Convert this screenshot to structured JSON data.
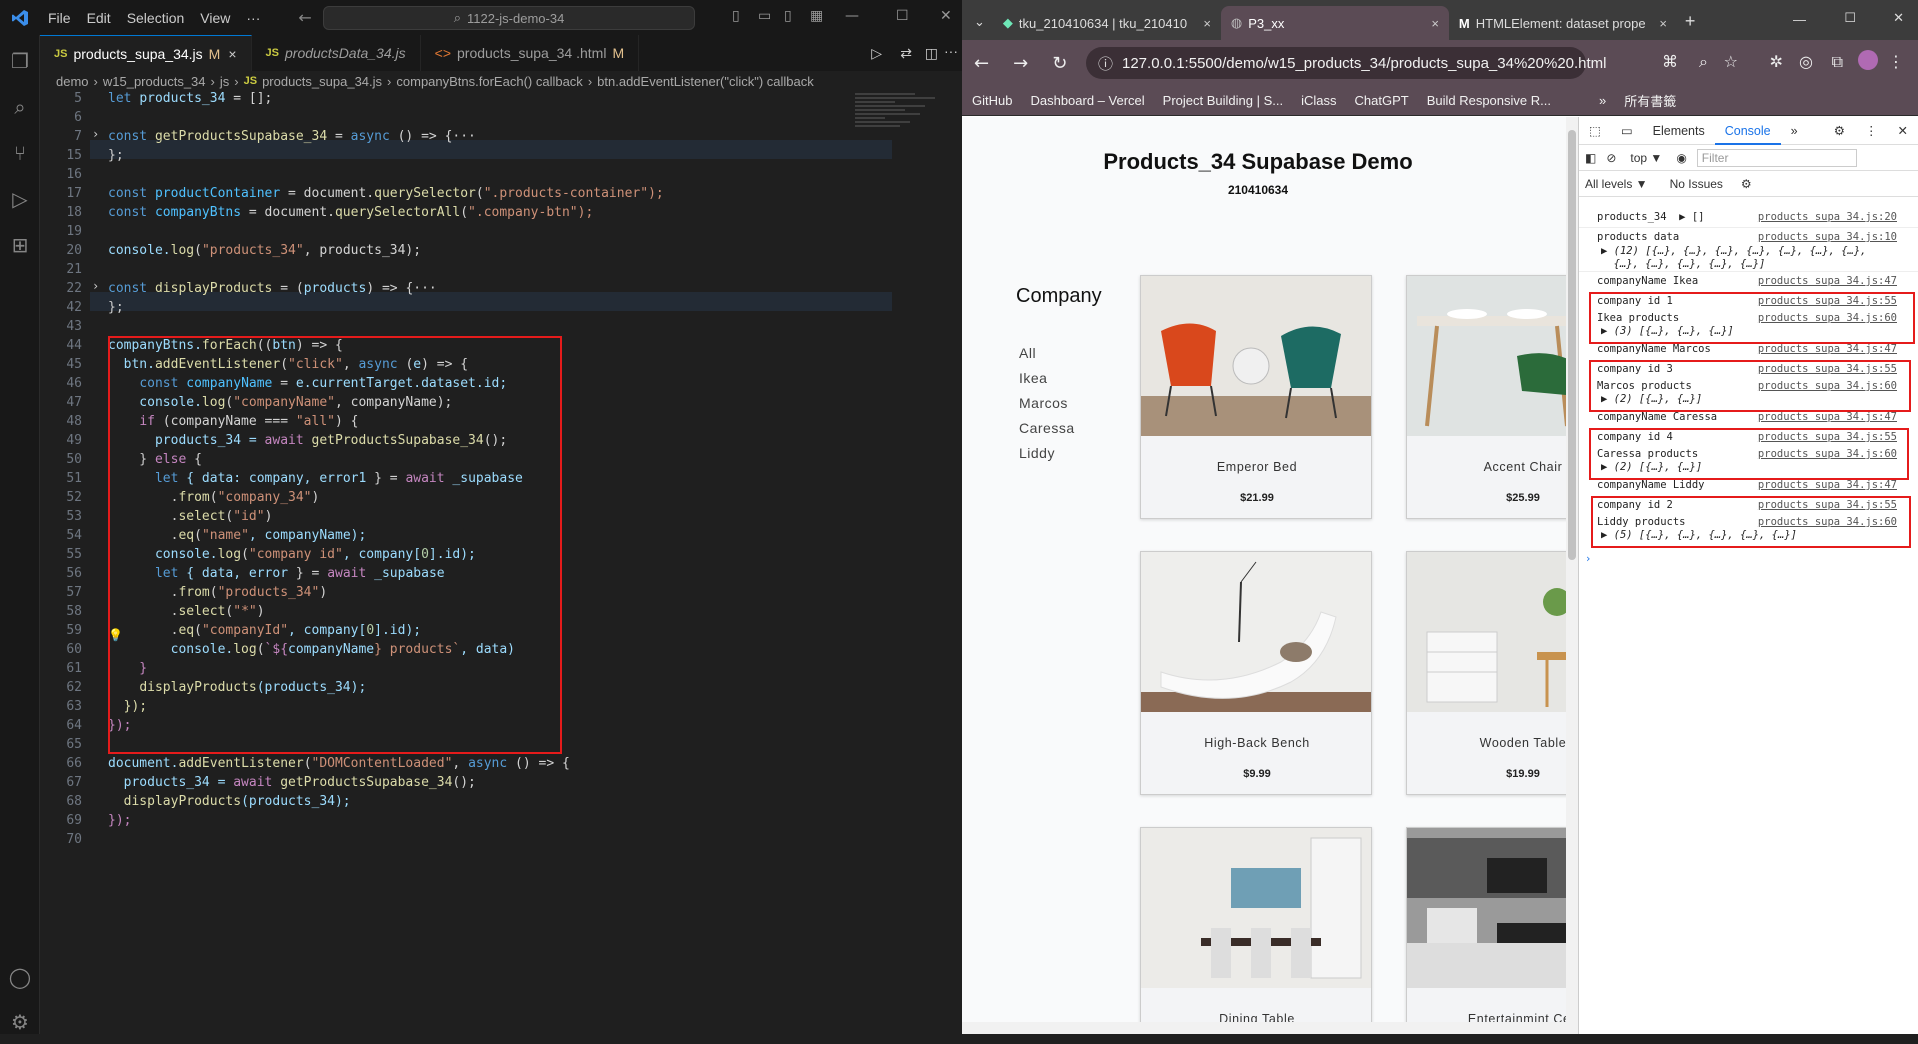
{
  "vscode": {
    "menus": [
      "File",
      "Edit",
      "Selection",
      "View",
      "···"
    ],
    "command_center": "1122-js-demo-34",
    "tabs": [
      {
        "kind": "JS",
        "label": "products_supa_34.js",
        "badge": "M",
        "active": true,
        "close": "×"
      },
      {
        "kind": "JS",
        "label": "productsData_34.js",
        "badge": "",
        "active": false,
        "close": ""
      },
      {
        "kind": "<>",
        "label": "products_supa_34 .html",
        "badge": "M",
        "active": false,
        "close": ""
      }
    ],
    "breadcrumbs": [
      "demo",
      "›",
      "w15_products_34",
      "›",
      "js",
      "›",
      "JS",
      "products_supa_34.js",
      "›",
      "companyBtns.forEach() callback",
      "›",
      "btn.addEventListener(\"click\") callback"
    ],
    "line_numbers": [
      "5",
      "6",
      "7",
      "15",
      "16",
      "17",
      "18",
      "19",
      "20",
      "21",
      "22",
      "42",
      "43",
      "44",
      "45",
      "46",
      "47",
      "48",
      "49",
      "50",
      "51",
      "52",
      "53",
      "54",
      "55",
      "56",
      "57",
      "58",
      "59",
      "60",
      "61",
      "62",
      "63",
      "64",
      "65",
      "66",
      "67",
      "68",
      "69",
      "70"
    ]
  },
  "code": {
    "l5": [
      "let ",
      "products_34",
      " = [];"
    ],
    "l7": [
      "const ",
      "getProductsSupabase_34",
      " = ",
      "async",
      " () => {",
      "···"
    ],
    "l15": "};",
    "l17": [
      "const ",
      "productContainer",
      " = document.",
      "querySelector",
      "(",
      ".products-container",
      "\");"
    ],
    "l18": [
      "const ",
      "companyBtns",
      " = document.",
      "querySelectorAll",
      "(",
      ".company-btn",
      "\");"
    ],
    "l20": [
      "console.",
      "log",
      "(",
      "\"products_34\"",
      ", products_34);"
    ],
    "l22": [
      "const ",
      "displayProducts",
      " = (",
      "products",
      ") => {",
      "···"
    ],
    "l42": "};",
    "l44": [
      "companyBtns.",
      "forEach",
      "((",
      "btn",
      ") => {"
    ],
    "l45": [
      "  btn.",
      "addEventListener",
      "(",
      "\"click\"",
      ", ",
      "async",
      " (",
      "e",
      ") => {"
    ],
    "l46": [
      "    ",
      "const ",
      "companyName",
      " = ",
      "e",
      ".currentTarget.dataset.id;"
    ],
    "l47": [
      "    console.",
      "log",
      "(",
      "\"companyName\"",
      ", companyName);"
    ],
    "l48": [
      "    ",
      "if",
      " (companyName === ",
      "\"all\"",
      ") {"
    ],
    "l49": [
      "      products_34 = ",
      "await ",
      "getProductsSupabase_34",
      "();"
    ],
    "l50": [
      "    } ",
      "else",
      " {"
    ],
    "l51": [
      "      ",
      "let",
      " { data: company, ",
      "error1",
      " } = ",
      "await",
      " _supabase"
    ],
    "l52": [
      "        .",
      "from",
      "(",
      "\"company_34\"",
      ")"
    ],
    "l53": [
      "        .",
      "select",
      "(",
      "\"id\"",
      ")"
    ],
    "l54": [
      "        .",
      "eq",
      "(",
      "\"name\"",
      ", companyName);"
    ],
    "l55": [
      "      console.",
      "log",
      "(",
      "\"company id\"",
      ", company[",
      "0",
      "].id);"
    ],
    "l56": [
      "      ",
      "let",
      " { data, ",
      "error",
      " } = ",
      "await",
      " _supabase"
    ],
    "l57": [
      "        .",
      "from",
      "(",
      "\"products_34\"",
      ")"
    ],
    "l58": [
      "        .",
      "select",
      "(",
      "\"*\"",
      ")"
    ],
    "l59": [
      "        .",
      "eq",
      "(",
      "\"companyId\"",
      ", company[",
      "0",
      "].id);"
    ],
    "l60": [
      "        console.",
      "log",
      "(",
      "`${",
      "companyName",
      "} products`",
      ", data)"
    ],
    "l61": "    }",
    "l62": [
      "    ",
      "displayProducts",
      "(products_34);"
    ],
    "l63": "  });",
    "l64": "});",
    "l66": [
      "document.",
      "addEventListener",
      "(",
      "\"DOMContentLoaded\"",
      ", ",
      "async",
      " () => {"
    ],
    "l67": [
      "  products_34 = ",
      "await ",
      "getProductsSupabase_34",
      "();"
    ],
    "l68": [
      "  ",
      "displayProducts",
      "(products_34);"
    ],
    "l69": "});"
  },
  "browser": {
    "tabs": [
      {
        "label": "tku_210410634 | tku_210410",
        "close": "×"
      },
      {
        "label": "P3_xx",
        "close": "×"
      },
      {
        "label": "HTMLElement: dataset prope",
        "close": "×"
      }
    ],
    "url": "127.0.0.1:5500/demo/w15_products_34/products_supa_34%20%20.html",
    "bookmarks": [
      "GitHub",
      "Dashboard – Vercel",
      "Project Building | S...",
      "iClass",
      "ChatGPT",
      "Build Responsive R...",
      "»",
      "所有書籤"
    ]
  },
  "page": {
    "title": "Products_34 Supabase Demo",
    "subtitle": "210410634",
    "company_heading": "Company",
    "companies": [
      "All",
      "Ikea",
      "Marcos",
      "Caressa",
      "Liddy"
    ],
    "products": [
      {
        "name": "Emperor Bed",
        "price": "$21.99"
      },
      {
        "name": "Accent Chair",
        "price": "$25.99"
      },
      {
        "name": "High-Back Bench",
        "price": "$9.99"
      },
      {
        "name": "Wooden Table",
        "price": "$19.99"
      },
      {
        "name": "Dining Table",
        "price": ""
      },
      {
        "name": "Entertainmint Cen",
        "price": ""
      }
    ]
  },
  "devtools": {
    "tabs": [
      "Elements",
      "Console",
      "»"
    ],
    "context": "top ▼",
    "filter_placeholder": "Filter",
    "levels": "All levels ▼",
    "issues": "No Issues",
    "logs": [
      {
        "text": "products_34  ▶ []",
        "src": "products supa 34.js:20"
      },
      {
        "text": "products data",
        "src": "products supa 34.js:10"
      },
      {
        "text": "▶ (12) [{…}, {…}, {…}, {…}, {…}, {…}, {…},",
        "src": ""
      },
      {
        "text": "  {…}, {…}, {…}, {…}, {…}]",
        "src": ""
      },
      {
        "text": "companyName Ikea",
        "src": "products supa 34.js:47"
      },
      {
        "text": "company id 1",
        "src": "products supa 34.js:55"
      },
      {
        "text": "Ikea products",
        "src": "products supa 34.js:60"
      },
      {
        "text": "▶ (3) [{…}, {…}, {…}]",
        "src": ""
      },
      {
        "text": "companyName Marcos",
        "src": "products supa 34.js:47"
      },
      {
        "text": "company id 3",
        "src": "products supa 34.js:55"
      },
      {
        "text": "Marcos products",
        "src": "products supa 34.js:60"
      },
      {
        "text": "▶ (2) [{…}, {…}]",
        "src": ""
      },
      {
        "text": "companyName Caressa",
        "src": "products supa 34.js:47"
      },
      {
        "text": "company id 4",
        "src": "products supa 34.js:55"
      },
      {
        "text": "Caressa products",
        "src": "products supa 34.js:60"
      },
      {
        "text": "▶ (2) [{…}, {…}]",
        "src": ""
      },
      {
        "text": "companyName Liddy",
        "src": "products supa 34.js:47"
      },
      {
        "text": "company id 2",
        "src": "products supa 34.js:55"
      },
      {
        "text": "Liddy products",
        "src": "products supa 34.js:60"
      },
      {
        "text": "▶ (5) [{…}, {…}, {…}, {…}, {…}]",
        "src": ""
      },
      {
        "text": "›",
        "src": ""
      }
    ]
  },
  "colors": {
    "accent": "#0078d4",
    "highlight_box": "#e51b1b",
    "browser_frame": "#5b4b55"
  }
}
